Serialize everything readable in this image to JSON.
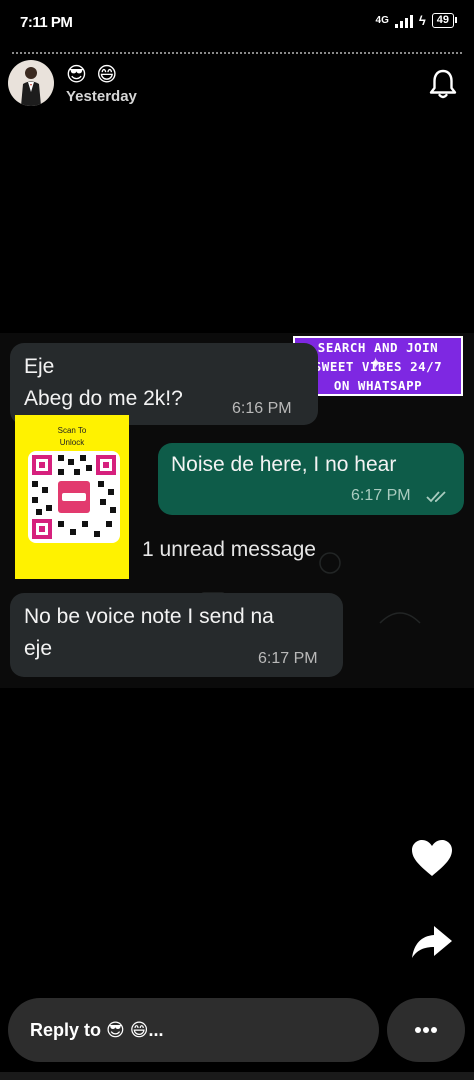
{
  "status_bar": {
    "time": "7:11 PM",
    "network": "4G",
    "battery": "49"
  },
  "header": {
    "emojis": "😎 😄",
    "time_ago": "Yesterday"
  },
  "messages": [
    {
      "text_line1": "Eje",
      "text_line2": "Abeg do me 2k!?",
      "time": "6:16 PM",
      "direction": "incoming"
    },
    {
      "text": "Noise de here, I no hear",
      "time": "6:17 PM",
      "direction": "outgoing",
      "read": true
    },
    {
      "text_line1": "No be voice note I send na",
      "text_line2": "eje",
      "time": "6:17 PM",
      "direction": "incoming"
    }
  ],
  "unread_label": "1 unread message",
  "promo": {
    "line1": "SEARCH AND JOIN",
    "line2": "SWEET VIBES 24/7",
    "line3": "ON WHATSAPP"
  },
  "qr_card": {
    "title_line1": "Scan To",
    "title_line2": "Unlock"
  },
  "reply": {
    "label": "Reply to 😎 😄..."
  },
  "icons": {
    "bell": "bell-icon",
    "heart": "heart-icon",
    "share": "share-icon",
    "more": "more-icon",
    "check": "double-check-icon"
  },
  "colors": {
    "incoming_bubble": "#262a2c",
    "outgoing_bubble": "#0e5c49",
    "promo": "#7e28e2",
    "qr_card": "#fff200"
  }
}
